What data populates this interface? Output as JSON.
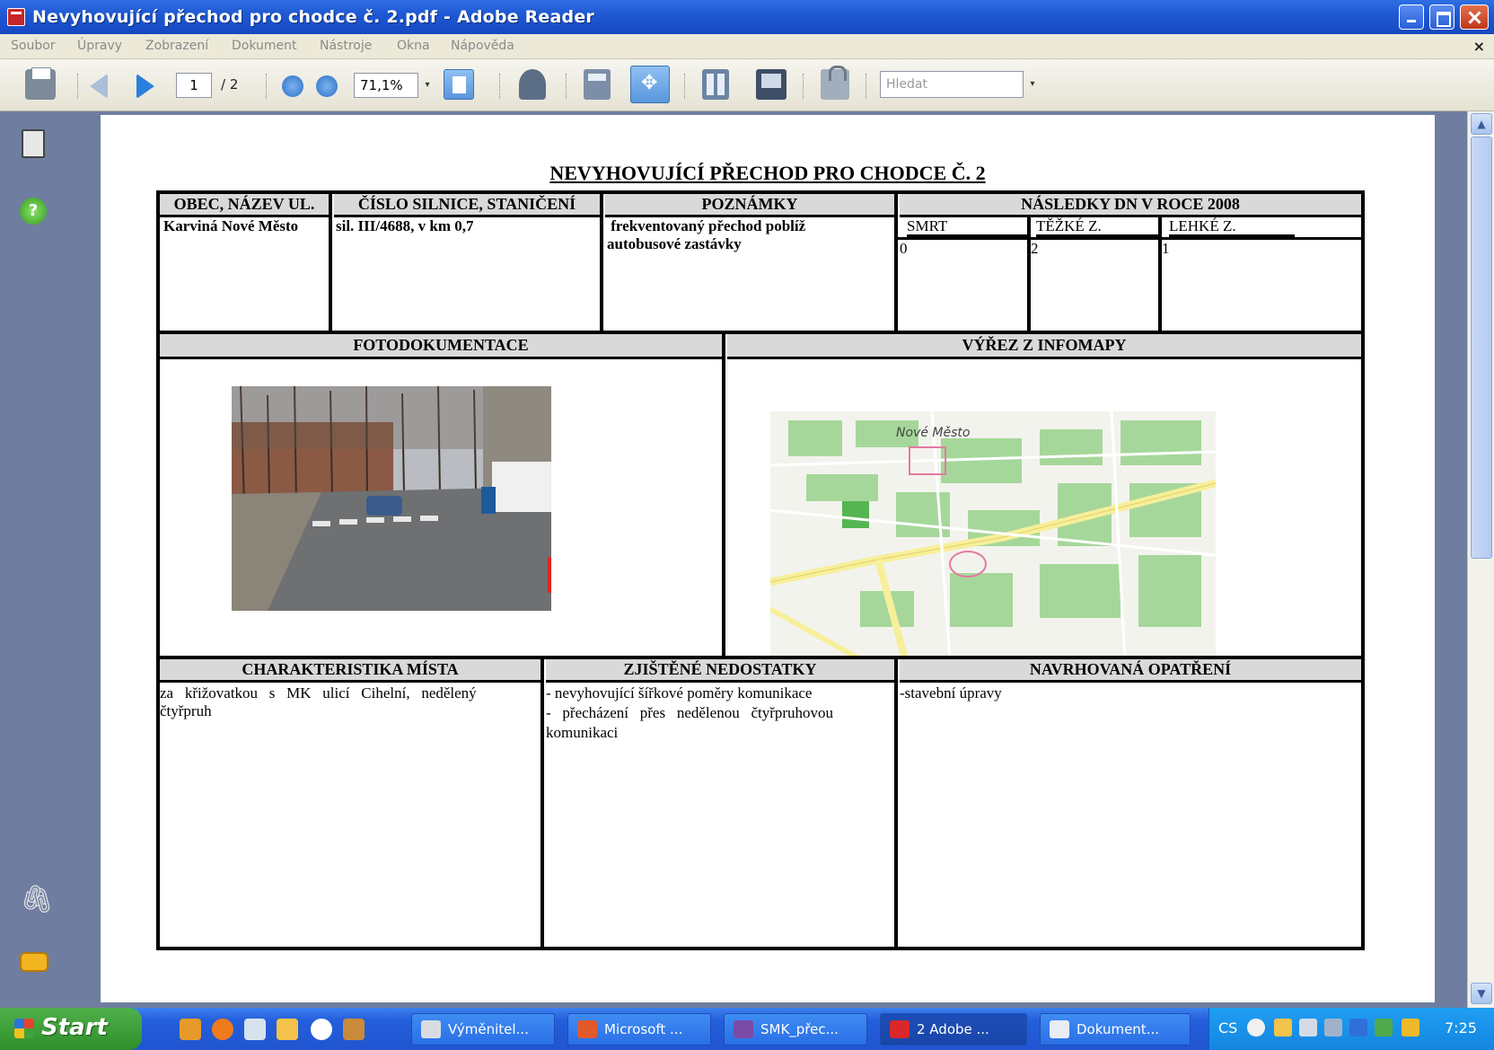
{
  "window": {
    "title": "Nevyhovující přechod pro chodce č. 2.pdf - Adobe Reader"
  },
  "menu": {
    "items": [
      "Soubor",
      "Úpravy",
      "Zobrazení",
      "Dokument",
      "Nástroje",
      "Okna",
      "Nápověda"
    ],
    "close": "×"
  },
  "toolbar": {
    "page_current": "1",
    "page_total": "/ 2",
    "zoom": "71,1%",
    "search_placeholder": "Hledat",
    "dropdown_glyph": "▾"
  },
  "document": {
    "title": "NEVYHOVUJÍCÍ PŘECHOD PRO CHODCE Č. 2",
    "headers": {
      "obec": "OBEC, NÁZEV UL.",
      "silnice": "ČÍSLO SILNICE, STANIČENÍ",
      "poznamky": "POZNÁMKY",
      "nasledky": "NÁSLEDKY DN V ROCE 2008",
      "smrt": "SMRT",
      "tezke": "TĚŽKÉ Z.",
      "lehke": "LEHKÉ Z.",
      "foto": "FOTODOKUMENTACE",
      "mapa": "VÝŘEZ Z INFOMAPY",
      "charakteristika": "CHARAKTERISTIKA MÍSTA",
      "nedostatky": "ZJIŠTĚNÉ NEDOSTATKY",
      "opatreni": "NAVRHOVANÁ OPATŘENÍ"
    },
    "values": {
      "obec": "Karviná Nové Město",
      "silnice": "sil. III/4688, v km 0,7",
      "poznamky_1": " frekventovaný přechod poblíž",
      "poznamky_2": "autobusové zastávky",
      "smrt": "0",
      "tezke": "2",
      "lehke": "1",
      "charakteristika_1": "za   křižovatkou   s   MK   ulicí   Cihelní,   nedělený",
      "charakteristika_2": "čtyřpruh",
      "nedostatky_1": "- nevyhovující šířkové poměry komunikace",
      "nedostatky_2": "-   přecházení   přes   nedělenou   čtyřpruhovou",
      "nedostatky_3": "komunikaci",
      "opatreni": "-stavební úpravy"
    },
    "map_label": "Nové Město"
  },
  "taskbar": {
    "start": "Start",
    "buttons": [
      "Výměnitel...",
      "Microsoft ...",
      "SMK_přec...",
      "2 Adobe ...",
      "Dokument..."
    ],
    "language": "CS",
    "clock": "7:25"
  }
}
